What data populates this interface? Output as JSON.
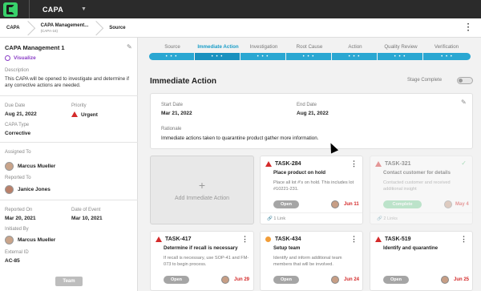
{
  "app": {
    "title": "CAPA"
  },
  "breadcrumb": [
    {
      "label": "CAPA",
      "sub": ""
    },
    {
      "label": "CAPA Management...",
      "sub": "(CAPA-16)"
    },
    {
      "label": "Source",
      "sub": ""
    }
  ],
  "sidebar": {
    "title": "CAPA Management 1",
    "visualize": "Visualize",
    "description_label": "Description",
    "description": "This CAPA will be opened to investigate and determine if any corrective actions are needed.",
    "due_date_label": "Due Date",
    "due_date": "Aug 21, 2022",
    "priority_label": "Priority",
    "priority": "Urgent",
    "capa_type_label": "CAPA Type",
    "capa_type": "Corrective",
    "assigned_to_label": "Assigned To",
    "assigned_to": "Marcus Mueller",
    "reported_to_label": "Reported To",
    "reported_to": "Janice Jones",
    "reported_on_label": "Reported On",
    "reported_on": "Mar 20, 2021",
    "date_of_event_label": "Date of Event",
    "date_of_event": "Mar 10, 2021",
    "initiated_by_label": "Initiated By",
    "initiated_by": "Marcus Mueller",
    "external_id_label": "External ID",
    "external_id": "AC-85",
    "team_button": "Team"
  },
  "stepper": {
    "steps": [
      "Source",
      "Immediate Action",
      "Investigation",
      "Root Cause",
      "Action",
      "Quality Review",
      "Verification"
    ],
    "active_index": 1,
    "dots": "• • •"
  },
  "main": {
    "title": "Immediate Action",
    "stage_complete_label": "Stage Complete",
    "start_date_label": "Start Date",
    "start_date": "Mar 21, 2022",
    "end_date_label": "End Date",
    "end_date": "Aug 21, 2022",
    "rationale_label": "Rationale",
    "rationale": "Immediate actions taken to quarantine product gather more information.",
    "add_label": "Add Immediate Action",
    "add_plus": "+"
  },
  "tasks": [
    {
      "id": "TASK-284",
      "name": "Place product on hold",
      "desc": "Place all lot #'s on hold. This includes lot #10221-231.",
      "status": "Open",
      "date": "Jun 11",
      "links": "1 Link",
      "icon": "warning-icon"
    },
    {
      "id": "TASK-321",
      "name": "Contact customer for details",
      "desc": "Contacted customer and received additional insight",
      "status": "Complete",
      "date": "May 4",
      "links": "2 Links",
      "icon": "warning-icon"
    },
    {
      "id": "TASK-417",
      "name": "Determine if recall is necessary",
      "desc": "If recall is necessary, use SOP-41 and FM-073 to begin process.",
      "status": "Open",
      "date": "Jun 29",
      "icon": "warning-icon"
    },
    {
      "id": "TASK-434",
      "name": "Setup team",
      "desc": "Identify and inform additional team members that will be involved.",
      "status": "Open",
      "date": "Jun 24",
      "icon": "medium-priority-icon"
    },
    {
      "id": "TASK-519",
      "name": "Identify and quarantine",
      "desc": "",
      "status": "Open",
      "date": "Jun 25",
      "icon": "warning-icon"
    }
  ],
  "colors": {
    "accent": "#2aa7d2",
    "urgent": "#d42a2a",
    "visualize": "#8a3dc6",
    "logo": "#39d26b"
  }
}
